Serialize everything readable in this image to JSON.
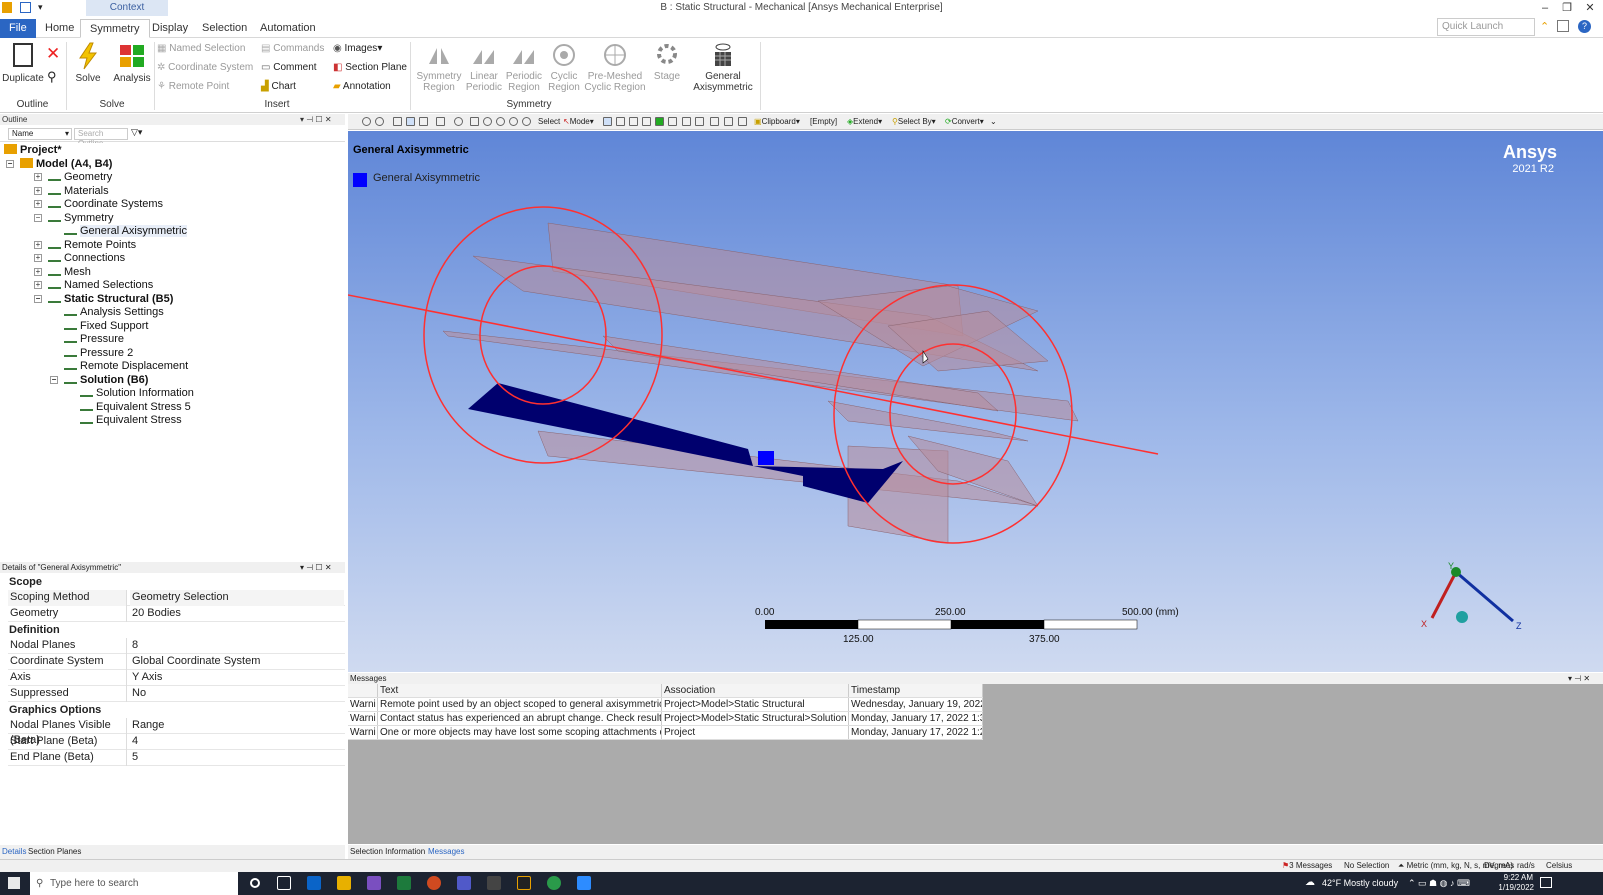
{
  "window": {
    "title": "B : Static Structural - Mechanical [Ansys Mechanical Enterprise]",
    "context_tab": "Context"
  },
  "tabs": [
    "File",
    "Home",
    "Symmetry",
    "Display",
    "Selection",
    "Automation"
  ],
  "quick_launch": {
    "placeholder": "Quick Launch"
  },
  "ribbon": {
    "outline_group": {
      "duplicate": "Duplicate",
      "label": "Outline"
    },
    "solve_group": {
      "solve": "Solve",
      "analysis": "Analysis",
      "label": "Solve"
    },
    "insert_group": {
      "named_selection": "Named Selection",
      "coordinate_system": "Coordinate System",
      "remote_point": "Remote Point",
      "commands": "Commands",
      "comment": "Comment",
      "chart": "Chart",
      "images": "Images",
      "section_plane": "Section Plane",
      "annotation": "Annotation",
      "label": "Insert"
    },
    "symmetry_group": {
      "symmetry_region": "Symmetry Region",
      "linear_periodic": "Linear Periodic",
      "periodic_region": "Periodic Region",
      "cyclic_region": "Cyclic Region",
      "pre_meshed": "Pre-Meshed Cyclic Region",
      "stage": "Stage",
      "general_axisymmetric": "General Axisymmetric",
      "label": "Symmetry"
    }
  },
  "toolbar": {
    "select": "Select",
    "mode": "Mode",
    "clipboard": "Clipboard",
    "empty": "[Empty]",
    "extend": "Extend",
    "select_by": "Select By",
    "convert": "Convert"
  },
  "outline": {
    "header": "Outline",
    "filter_name": "Name",
    "search_placeholder": "Search Outline",
    "tree": [
      {
        "label": "Project*",
        "level": 0,
        "bold": true
      },
      {
        "label": "Model (A4, B4)",
        "level": 1,
        "bold": true
      },
      {
        "label": "Geometry",
        "level": 2
      },
      {
        "label": "Materials",
        "level": 2
      },
      {
        "label": "Coordinate Systems",
        "level": 2
      },
      {
        "label": "Symmetry",
        "level": 2
      },
      {
        "label": "General Axisymmetric",
        "level": 3
      },
      {
        "label": "Remote Points",
        "level": 2
      },
      {
        "label": "Connections",
        "level": 2
      },
      {
        "label": "Mesh",
        "level": 2
      },
      {
        "label": "Named Selections",
        "level": 2
      },
      {
        "label": "Static Structural (B5)",
        "level": 2,
        "bold": true
      },
      {
        "label": "Analysis Settings",
        "level": 3
      },
      {
        "label": "Fixed Support",
        "level": 3
      },
      {
        "label": "Pressure",
        "level": 3
      },
      {
        "label": "Pressure 2",
        "level": 3
      },
      {
        "label": "Remote Displacement",
        "level": 3
      },
      {
        "label": "Solution (B6)",
        "level": 3,
        "bold": true
      },
      {
        "label": "Solution Information",
        "level": 4
      },
      {
        "label": "Equivalent Stress 5",
        "level": 4
      },
      {
        "label": "Equivalent Stress",
        "level": 4
      }
    ]
  },
  "details": {
    "header": "Details of \"General Axisymmetric\"",
    "sections": [
      {
        "title": "Scope",
        "rows": [
          {
            "k": "Scoping Method",
            "v": "Geometry Selection"
          },
          {
            "k": "Geometry",
            "v": "20 Bodies"
          }
        ]
      },
      {
        "title": "Definition",
        "rows": [
          {
            "k": "Nodal Planes",
            "v": "8"
          },
          {
            "k": "Coordinate System",
            "v": "Global Coordinate System"
          },
          {
            "k": "Axis",
            "v": "Y Axis"
          },
          {
            "k": "Suppressed",
            "v": "No"
          }
        ]
      },
      {
        "title": "Graphics Options",
        "rows": [
          {
            "k": "Nodal Planes Visible (Beta)",
            "v": "Range"
          },
          {
            "k": "Start Plane (Beta)",
            "v": "4"
          },
          {
            "k": "End Plane (Beta)",
            "v": "5"
          }
        ]
      }
    ],
    "bottom_tabs": [
      "Details",
      "Section Planes"
    ]
  },
  "viewport": {
    "title": "General Axisymmetric",
    "legend": "General Axisymmetric",
    "brand": "Ansys",
    "version": "2021 R2",
    "scale_top": [
      "0.00",
      "250.00",
      "500.00 (mm)"
    ],
    "scale_bottom": [
      "125.00",
      "375.00"
    ],
    "axes": {
      "x": "X",
      "y": "Y",
      "z": "Z"
    },
    "colors": {
      "legend_blue": "#0000ff",
      "body_navy": "#00006e",
      "circle_red": "#ff3030"
    }
  },
  "messages": {
    "header": "Messages",
    "columns": [
      "Text",
      "Association",
      "Timestamp"
    ],
    "rows": [
      {
        "type": "Warni",
        "text": "Remote point used by an object scoped to general axisymmetric b",
        "assoc": "Project>Model>Static Structural",
        "time": "Wednesday, January 19, 2022"
      },
      {
        "type": "Warni",
        "text": "Contact status has experienced an abrupt change.  Check results c",
        "assoc": "Project>Model>Static Structural>Solution",
        "time": "Monday, January 17, 2022 1:3"
      },
      {
        "type": "Warni",
        "text": "One or more objects may have lost some scoping attachments du",
        "assoc": "Project",
        "time": "Monday, January 17, 2022 1:2"
      }
    ],
    "bottom_tabs": [
      "Selection Information",
      "Messages"
    ]
  },
  "statusbar": {
    "messages": "3 Messages",
    "selection": "No Selection",
    "units": "Metric (mm, kg, N, s, mV, mA)",
    "degrees": "Degrees",
    "rads": "rad/s",
    "temp": "Celsius"
  },
  "taskbar": {
    "search_placeholder": "Type here to search",
    "weather": "42°F  Mostly cloudy",
    "time": "9:22 AM",
    "date": "1/19/2022"
  }
}
